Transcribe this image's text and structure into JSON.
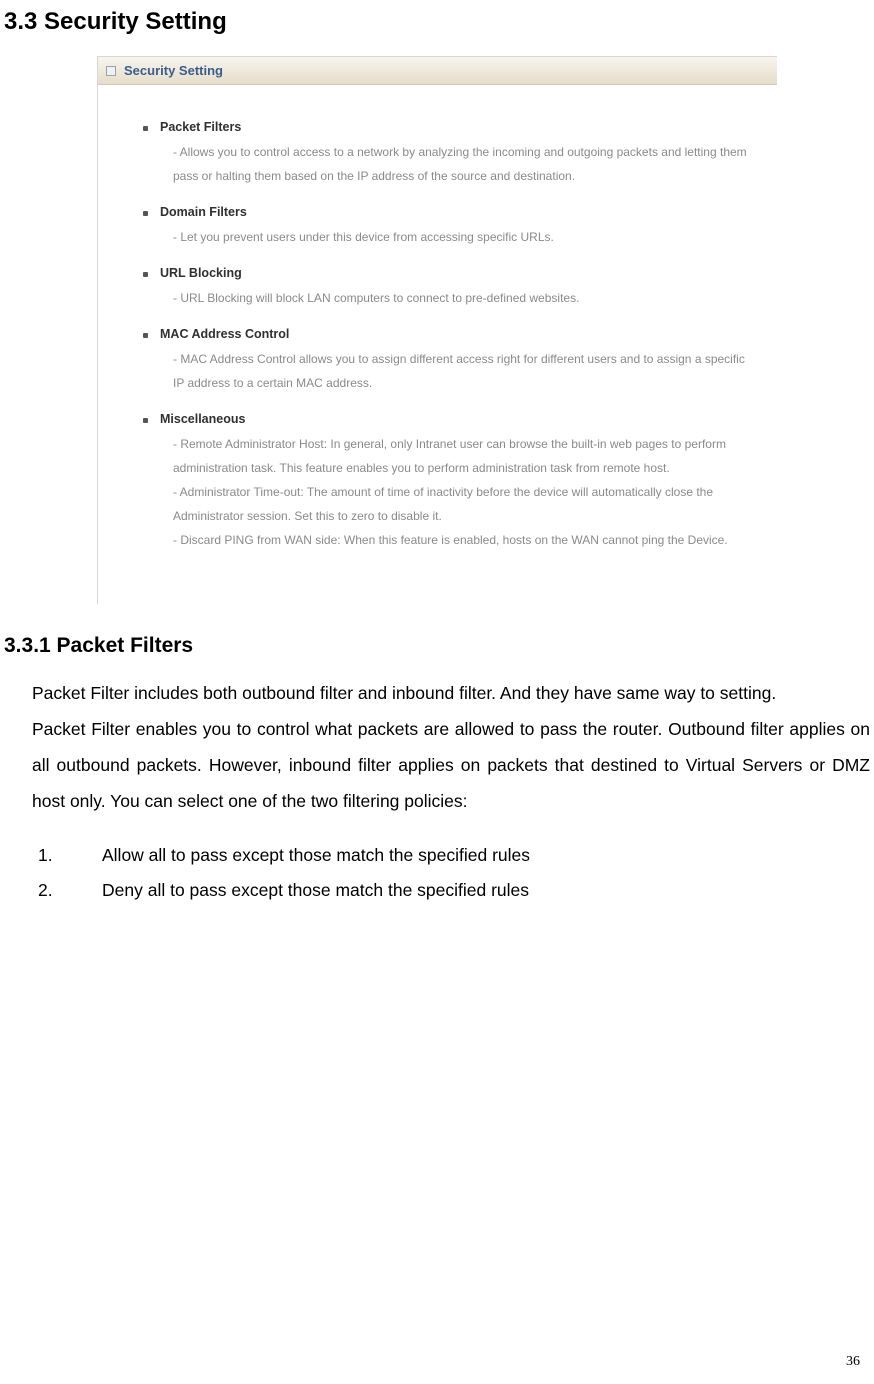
{
  "heading_main": "3.3 Security Setting",
  "screenshot": {
    "title": "Security Setting",
    "sections": [
      {
        "title": "Packet Filters",
        "body": "- Allows you to control access to a network by analyzing the incoming and outgoing packets and letting them pass or halting them based on the IP address of the source and destination."
      },
      {
        "title": "Domain Filters",
        "body": "- Let you prevent users under this device from accessing specific URLs."
      },
      {
        "title": "URL Blocking",
        "body": "- URL Blocking will block LAN computers to connect to pre-defined websites."
      },
      {
        "title": "MAC Address Control",
        "body": "- MAC Address Control allows you to assign different access right for different users and to assign a specific IP address to a certain MAC address."
      },
      {
        "title": "Miscellaneous",
        "body": "- Remote Administrator Host: In general, only Intranet user can browse the built-in web pages to perform administration task. This feature enables you to perform administration task from remote host.\n- Administrator Time-out: The amount of time of inactivity before the device will automatically close the Administrator session. Set this to zero to disable it.\n- Discard PING from WAN side: When this feature is enabled, hosts on the WAN cannot ping the Device."
      }
    ]
  },
  "heading_sub": "3.3.1 Packet Filters",
  "para1": "Packet Filter includes both outbound filter and inbound filter. And they have same way to setting.",
  "para2": "Packet Filter enables you to control what packets are allowed to pass the router. Outbound filter applies on all outbound packets. However, inbound filter applies on packets that destined to Virtual Servers or DMZ host only. You can select one of the two filtering policies:",
  "policies": [
    "Allow all to pass except those match the specified rules",
    "Deny all to pass except those match the specified rules"
  ],
  "page_number": "36"
}
